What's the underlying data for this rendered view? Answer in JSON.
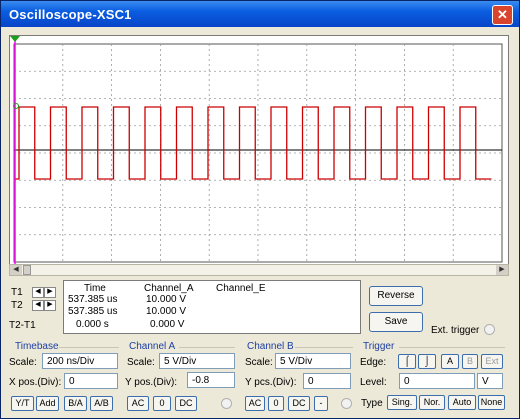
{
  "window": {
    "title": "Oscilloscope-XSC1",
    "close_label": "✕"
  },
  "cursors": {
    "t1_label": "T1",
    "t2_label": "T2",
    "t2t1_label": "T2-T1"
  },
  "readout": {
    "headers": {
      "time": "Time",
      "channel_a": "Channel_A",
      "channel_b": "Channel_E"
    },
    "rows": [
      {
        "time": "537.385 us",
        "channel_a": "10.000 V",
        "channel_b": ""
      },
      {
        "time": "537.385 us",
        "channel_a": "10.000 V",
        "channel_b": ""
      },
      {
        "time": "0.000 s",
        "channel_a": "0.000 V",
        "channel_b": ""
      }
    ]
  },
  "actions": {
    "reverse": "Reverse",
    "save": "Save",
    "ext_trigger": "Ext. trigger"
  },
  "timebase": {
    "title": "Timebase",
    "scale_label": "Scale:",
    "scale_value": "200 ns/Div",
    "xpos_label": "X pos.(Div):",
    "xpos_value": "0",
    "buttons": [
      "Y/T",
      "Add",
      "B/A",
      "A/B"
    ]
  },
  "channel_a": {
    "title": "Channel A",
    "scale_label": "Scale:",
    "scale_value": "5  V/Div",
    "ypos_label": "Y pos.(Div):",
    "ypos_value": "-0.8",
    "buttons": [
      "AC",
      "0",
      "DC"
    ]
  },
  "channel_b": {
    "title": "Channel B",
    "scale_label": "Scale:",
    "scale_value": "5  V/Div",
    "ypos_label": "Y pcs.(Div):",
    "ypos_value": "0",
    "buttons": [
      "AC",
      "0",
      "DC",
      "-"
    ]
  },
  "trigger": {
    "title": "Trigger",
    "edge_label": "Edge:",
    "edge_buttons": [
      "A",
      "B",
      "Ext"
    ],
    "level_label": "Level:",
    "level_value": "0",
    "level_unit": "V",
    "type_label": "Type",
    "type_buttons": [
      "Sing.",
      "Nor.",
      "Auto",
      "None"
    ]
  },
  "colors": {
    "trace_a": "#cc0000",
    "trace_b": "#000000",
    "cursor": "#ff00ff",
    "grid": "#9a9a9a"
  }
}
